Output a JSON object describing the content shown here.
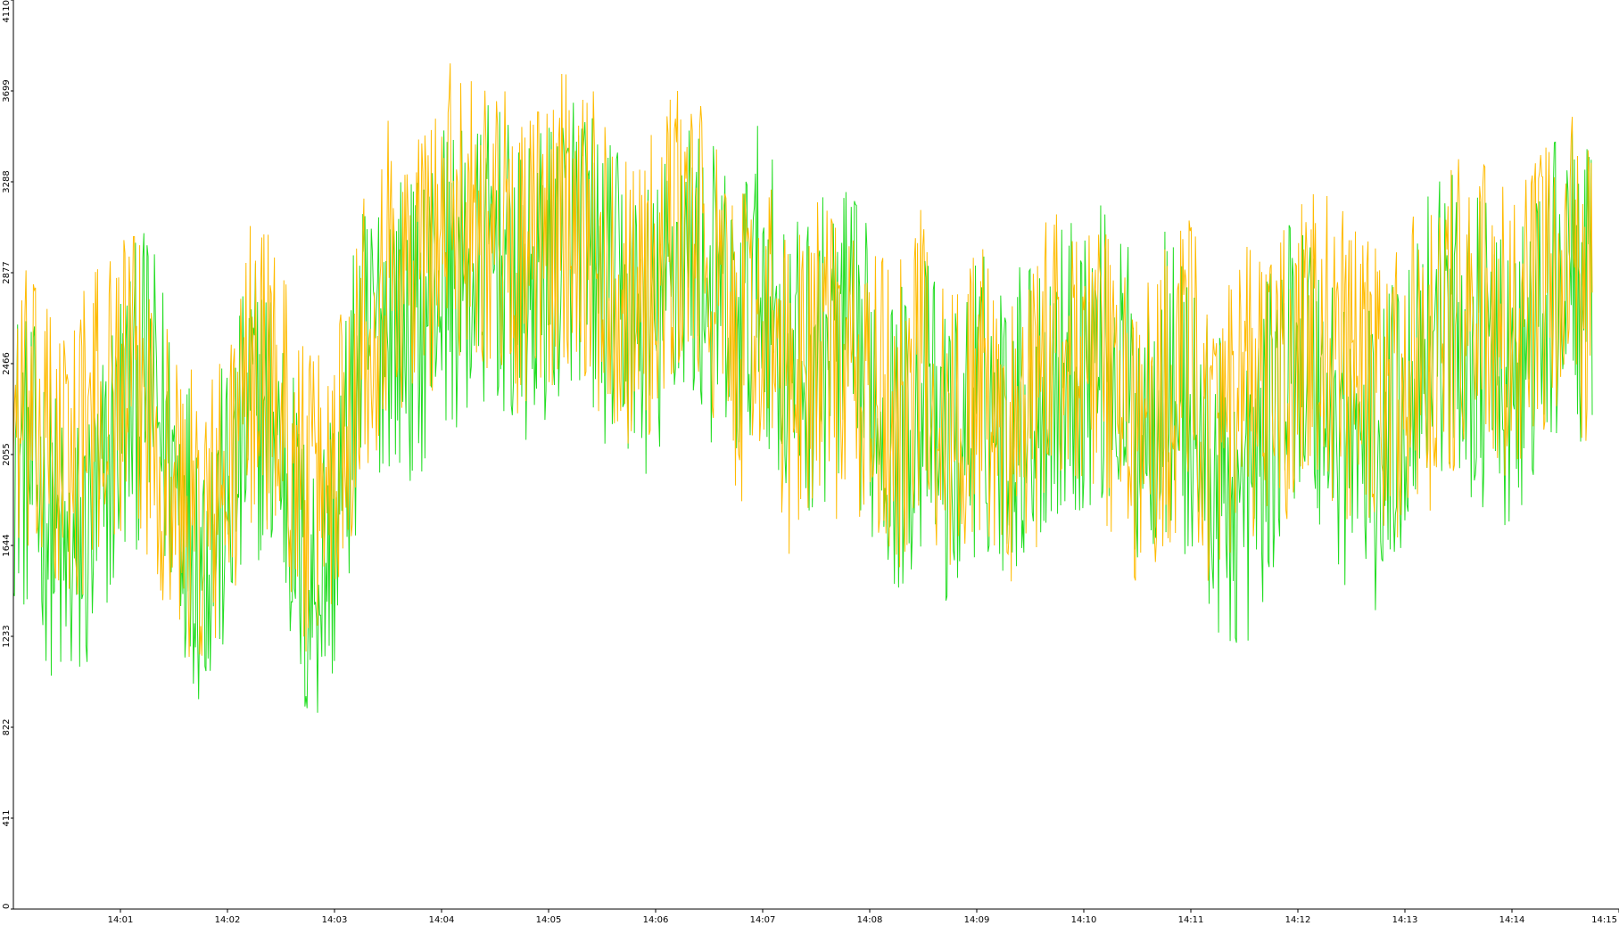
{
  "chart_data": {
    "type": "line",
    "title": "",
    "xlabel": "",
    "ylabel": "",
    "ylim": [
      0,
      4110
    ],
    "y_ticks": [
      0,
      411,
      822,
      1233,
      1644,
      2055,
      2466,
      2877,
      3288,
      3699,
      4110
    ],
    "y_tick_labels": [
      "0",
      "411",
      "822",
      "1233",
      "1644",
      "2055",
      "2466",
      "2877",
      "3288",
      "3699",
      "4110"
    ],
    "x_range": [
      "14:00:00",
      "14:15:00"
    ],
    "x_tick_labels": [
      "14:01",
      "14:02",
      "14:03",
      "14:04",
      "14:05",
      "14:06",
      "14:07",
      "14:08",
      "14:09",
      "14:10",
      "14:11",
      "14:12",
      "14:13",
      "14:14",
      "14:15"
    ],
    "grid": false,
    "legend": "none",
    "series": [
      {
        "color": "#22dd22",
        "sample_interval_seconds": 15,
        "values": [
          2100,
          1900,
          1500,
          1700,
          2200,
          2400,
          2000,
          1600,
          1800,
          2300,
          2100,
          1400,
          1700,
          2500,
          2700,
          2600,
          2900,
          2800,
          3000,
          2700,
          2900,
          3100,
          2800,
          2700,
          2600,
          3000,
          2800,
          2600,
          2900,
          2400,
          2500,
          2600,
          2400,
          2100,
          2300,
          2000,
          2300,
          2200,
          2300,
          2400,
          2500,
          2500,
          2200,
          2400,
          2200,
          1900,
          1800,
          2200,
          2600,
          2300,
          2100,
          2000,
          2300,
          2700,
          2600,
          2500,
          2300,
          2600,
          2900,
          2700
        ]
      },
      {
        "color": "#ffbb00",
        "sample_interval_seconds": 15,
        "values": [
          2300,
          2100,
          2000,
          2200,
          2400,
          2300,
          1900,
          1700,
          1900,
          2500,
          2300,
          1800,
          2000,
          2600,
          2900,
          2900,
          3100,
          3200,
          3100,
          2900,
          3000,
          3200,
          2900,
          2800,
          2800,
          3100,
          2900,
          2500,
          2700,
          2300,
          2600,
          2400,
          2300,
          2200,
          2500,
          2100,
          2400,
          2100,
          2200,
          2600,
          2500,
          2400,
          2100,
          2300,
          2500,
          2000,
          2300,
          2300,
          2500,
          2600,
          2400,
          2300,
          2400,
          2500,
          2700,
          2700,
          2500,
          2700,
          3000,
          2700
        ]
      }
    ]
  }
}
